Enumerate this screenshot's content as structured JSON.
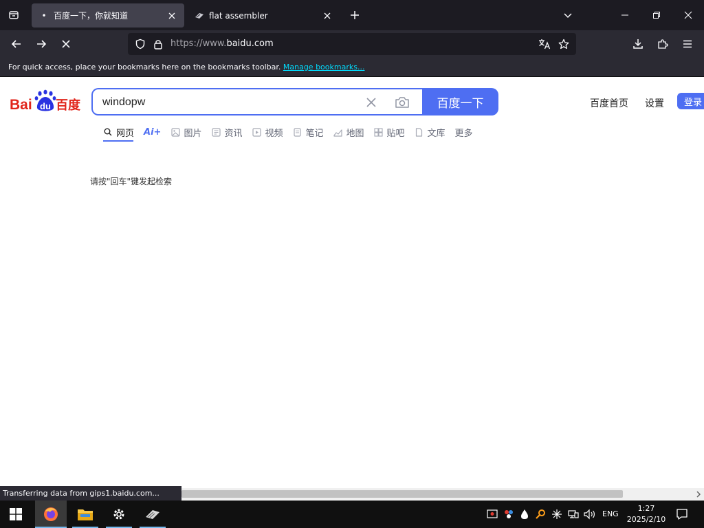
{
  "browser": {
    "tabs": [
      {
        "title": "百度一下，你就知道",
        "active": true
      },
      {
        "title": "flat assembler",
        "active": false
      }
    ],
    "url_prefix": "https://www.",
    "url_domain": "baidu.com",
    "bookmarks_bar": {
      "message": "For quick access, place your bookmarks here on the bookmarks toolbar.",
      "link": "Manage bookmarks..."
    },
    "status_text": "Transferring data from gips1.baidu.com..."
  },
  "page": {
    "logo_text_left": "Bai",
    "logo_text_paw": "du",
    "logo_text_right": "百度",
    "search_value": "windopw",
    "search_button": "百度一下",
    "top_links": {
      "home": "百度首页",
      "settings": "设置",
      "login": "登录"
    },
    "tabs": [
      {
        "label": "网页",
        "icon": "search-icon",
        "active": true
      },
      {
        "label": "Ai+",
        "icon": "",
        "active": false
      },
      {
        "label": "图片",
        "icon": "image-icon",
        "active": false
      },
      {
        "label": "资讯",
        "icon": "news-icon",
        "active": false
      },
      {
        "label": "视频",
        "icon": "video-icon",
        "active": false
      },
      {
        "label": "笔记",
        "icon": "note-icon",
        "active": false
      },
      {
        "label": "地图",
        "icon": "map-icon",
        "active": false
      },
      {
        "label": "贴吧",
        "icon": "forum-icon",
        "active": false
      },
      {
        "label": "文库",
        "icon": "document-icon",
        "active": false
      },
      {
        "label": "更多",
        "icon": "",
        "active": false
      }
    ],
    "hint": "请按\"回车\"键发起检索"
  },
  "taskbar": {
    "apps": [
      "windows-start",
      "firefox",
      "file-explorer",
      "settings",
      "flat-assembler"
    ],
    "language": "ENG",
    "time": "1:27",
    "date": "2025/2/10"
  },
  "colors": {
    "accent": "#4e6ef2",
    "tab_bg": "#1c1b22",
    "toolbar_bg": "#2b2a33"
  }
}
